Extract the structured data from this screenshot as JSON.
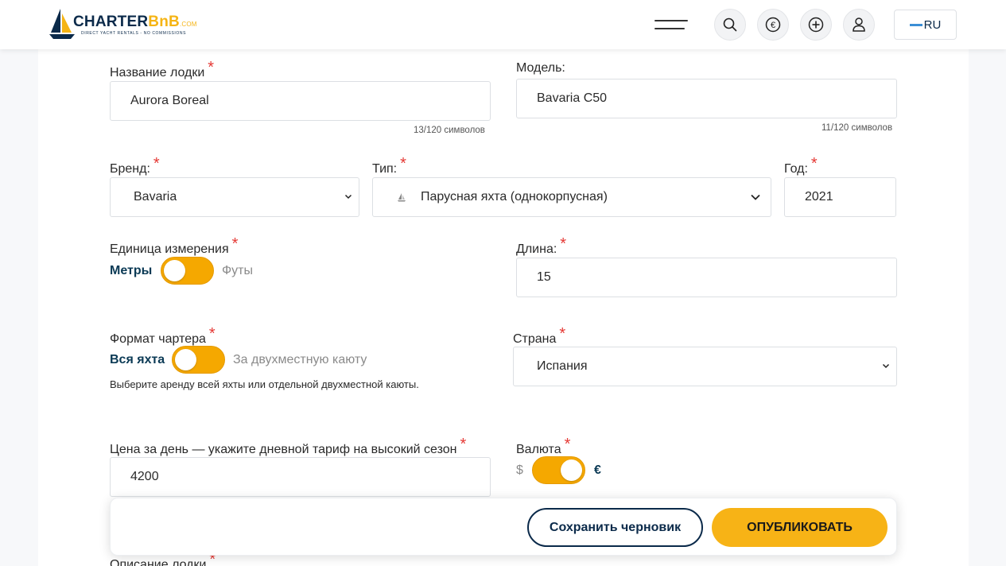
{
  "header": {
    "logo_main": "CHARTER",
    "logo_accent": "BnB",
    "logo_suffix": ".COM",
    "logo_tagline": "DIRECT YACHT RENTALS - NO COMMISSIONS",
    "language": "RU",
    "icons": [
      "menu-icon",
      "search-icon",
      "euro-icon",
      "add-icon",
      "user-icon"
    ]
  },
  "form": {
    "boat_name": {
      "label": "Название лодки",
      "value": "Aurora Boreal",
      "counter": "13/120 символов"
    },
    "model": {
      "label": "Модель:",
      "value": "Bavaria C50",
      "counter": "11/120 символов"
    },
    "brand": {
      "label": "Бренд:",
      "value": "Bavaria"
    },
    "type": {
      "label": "Тип:",
      "value": "Парусная яхта (однокорпусная)"
    },
    "year": {
      "label": "Год:",
      "value": "2021"
    },
    "unit": {
      "label": "Единица измерения",
      "option_on": "Метры",
      "option_off": "Футы",
      "selected_fraction": 0
    },
    "length": {
      "label": "Длина:",
      "value": "15"
    },
    "charter_format": {
      "label": "Формат чартера",
      "option_on": "Вся яхта",
      "option_off": "За двухместную каюту",
      "hint": "Выберите аренду всей яхты или отдельной двухместной каюты.",
      "selected_fraction": 0
    },
    "country": {
      "label": "Страна",
      "value": "Испания"
    },
    "price": {
      "label": "Цена за день — укажите дневной тариф на высокий сезон",
      "value": "4200"
    },
    "currency": {
      "label": "Валюта",
      "option_off": "$",
      "option_on": "€",
      "selected_fraction": 1
    },
    "description": {
      "label": "Описание лодки"
    },
    "required_mark": "*"
  },
  "actions": {
    "save_draft": "Сохранить черновик",
    "publish": "ОПУБЛИКОВАТЬ"
  },
  "colors": {
    "accent": "#f7b316",
    "navy": "#0b2a4a",
    "required": "#e53935"
  }
}
